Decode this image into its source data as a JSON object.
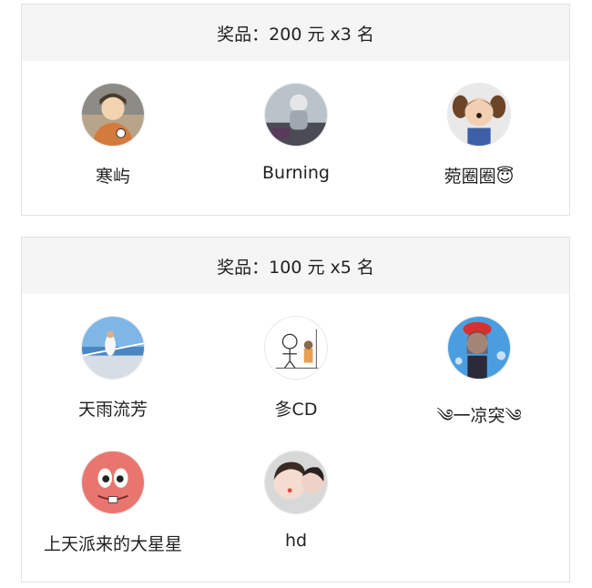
{
  "tiers": [
    {
      "header": "奖品：200 元 x3 名",
      "winners": [
        {
          "name": "寒屿",
          "avatar": "boy-cartoon-avatar"
        },
        {
          "name": "Burning",
          "avatar": "toy-figure-avatar"
        },
        {
          "name": "菀圈圈😇",
          "avatar": "puppy-filter-avatar"
        }
      ]
    },
    {
      "header": "奖品：100 元 x5 名",
      "winners": [
        {
          "name": "天雨流芳",
          "avatar": "seaside-deck-avatar"
        },
        {
          "name": "㣊CD",
          "avatar": "doodle-sketch-avatar"
        },
        {
          "name": "༄一凉突༄",
          "avatar": "anime-girl-avatar"
        },
        {
          "name": "上天派来的大星星",
          "avatar": "pink-cartoon-face-avatar"
        },
        {
          "name": "hd",
          "avatar": "selfie-avatar"
        }
      ]
    }
  ]
}
